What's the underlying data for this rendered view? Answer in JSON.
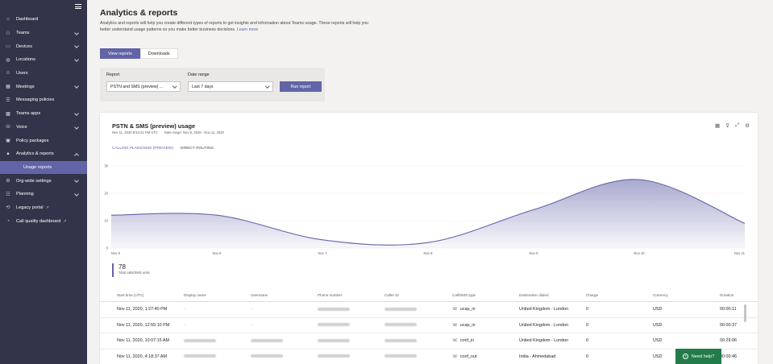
{
  "sidebar": {
    "items": [
      {
        "label": "Dashboard",
        "icon": "home-icon",
        "chevron": false
      },
      {
        "label": "Teams",
        "icon": "teams-icon",
        "chevron": true
      },
      {
        "label": "Devices",
        "icon": "devices-icon",
        "chevron": true
      },
      {
        "label": "Locations",
        "icon": "globe-icon",
        "chevron": true
      },
      {
        "label": "Users",
        "icon": "users-icon",
        "chevron": false
      },
      {
        "label": "Meetings",
        "icon": "calendar-icon",
        "chevron": true
      },
      {
        "label": "Messaging policies",
        "icon": "chat-icon",
        "chevron": false
      },
      {
        "label": "Teams apps",
        "icon": "apps-icon",
        "chevron": true
      },
      {
        "label": "Voice",
        "icon": "phone-icon",
        "chevron": true
      },
      {
        "label": "Policy packages",
        "icon": "package-icon",
        "chevron": false
      },
      {
        "label": "Analytics & reports",
        "icon": "analytics-icon",
        "chevron": true
      },
      {
        "label": "Usage reports",
        "sub": true
      },
      {
        "label": "Org-wide settings",
        "icon": "settings-icon",
        "chevron": true
      },
      {
        "label": "Planning",
        "icon": "planning-icon",
        "chevron": true
      },
      {
        "label": "Legacy portal",
        "icon": "legacy-icon",
        "external": true
      },
      {
        "label": "Call quality dashboard",
        "icon": "quality-icon",
        "external": true
      }
    ]
  },
  "page": {
    "title": "Analytics & reports",
    "description": "Analytics and reports will help you create different types of reports to get insights and information about Teams usage. These reports will help you better understand usage patterns so you make better business decisions.",
    "learn_more": "Learn more"
  },
  "tabs": {
    "view_reports": "View reports",
    "downloads": "Downloads"
  },
  "filters": {
    "report_label": "Report",
    "report_value": "PSTN and SMS (preview) ...",
    "date_label": "Date range",
    "date_value": "Last 7 days",
    "run_label": "Run report"
  },
  "report": {
    "title": "PSTN & SMS (preview) usage",
    "generated": "Nov 11, 2020 8:54:21 PM UTC",
    "date_range": "Date range: Nov 5, 2020 - Nov 11, 2020",
    "tabs": [
      "CALLING PLANS/SMS (PREVIEW)",
      "DIRECT ROUTING"
    ],
    "total_value": "78",
    "total_label": "Total calls/SMS units"
  },
  "chart_data": {
    "type": "area",
    "x": [
      "Nov 5",
      "Nov 6",
      "Nov 7",
      "Nov 8",
      "Nov 9",
      "Nov 10",
      "Nov 11"
    ],
    "values": [
      12,
      12,
      3,
      2,
      14,
      25,
      9
    ],
    "yticks": [
      "0",
      "10",
      "20",
      "30"
    ],
    "ylim": [
      0,
      30
    ],
    "color": "#6264a7"
  },
  "table": {
    "columns": [
      "Start time (UTC)",
      "Display name",
      "Username",
      "Phone number",
      "Caller ID",
      "Call/SMS type",
      "Destination dialed",
      "Charge",
      "Currency",
      "Duration"
    ],
    "rows": [
      {
        "start": "Nov 11, 2020, 1:27:40 PM",
        "display": "-",
        "username": "-",
        "type": "ucap_in",
        "dest": "United Kingdom - London",
        "charge": "0",
        "currency": "USD",
        "duration": "00:00:11"
      },
      {
        "start": "Nov 11, 2020, 12:55:10 PM",
        "display": "-",
        "username": "-",
        "type": "ucap_in",
        "dest": "United Kingdom - London",
        "charge": "0",
        "currency": "USD",
        "duration": "00:00:37"
      },
      {
        "start": "Nov 11, 2020, 10:07:15 AM",
        "display": "",
        "username": "",
        "type": "conf_in",
        "dest": "United Kingdom - London",
        "charge": "0",
        "currency": "USD",
        "duration": "00:29:06"
      },
      {
        "start": "Nov 11, 2020, 4:18:37 AM",
        "display": "",
        "username": "",
        "type": "conf_out",
        "dest": "India - Ahmedabad",
        "charge": "0",
        "currency": "USD",
        "duration": "00:00:46"
      }
    ]
  },
  "help": {
    "label": "Need help?"
  }
}
